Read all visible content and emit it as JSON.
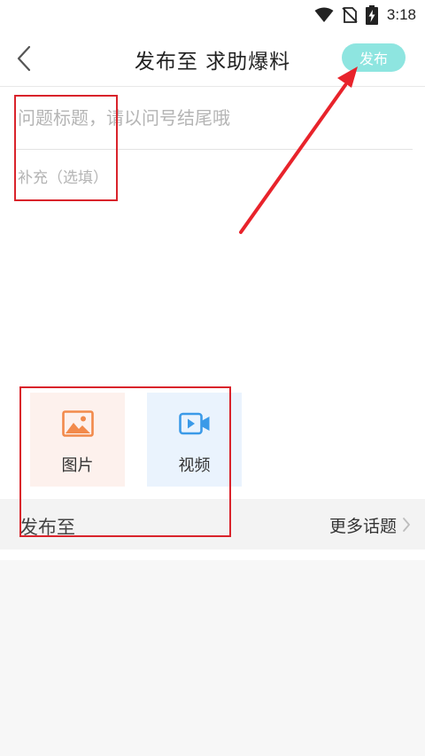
{
  "status_bar": {
    "time": "3:18"
  },
  "header": {
    "title": "发布至  求助爆料",
    "publish_label": "发布"
  },
  "form": {
    "question_placeholder": "问题标题，请以问号结尾哦",
    "question_value": "",
    "supplement_placeholder": "补充（选填）",
    "supplement_value": ""
  },
  "media": {
    "image_label": "图片",
    "video_label": "视频",
    "image_icon_color": "#f28a4b",
    "video_icon_color": "#3b9ae8"
  },
  "publish_to": {
    "label": "发布至",
    "more_topics_label": "更多话题"
  },
  "colors": {
    "accent": "#8ee5e0",
    "annotation": "#d9232b"
  }
}
